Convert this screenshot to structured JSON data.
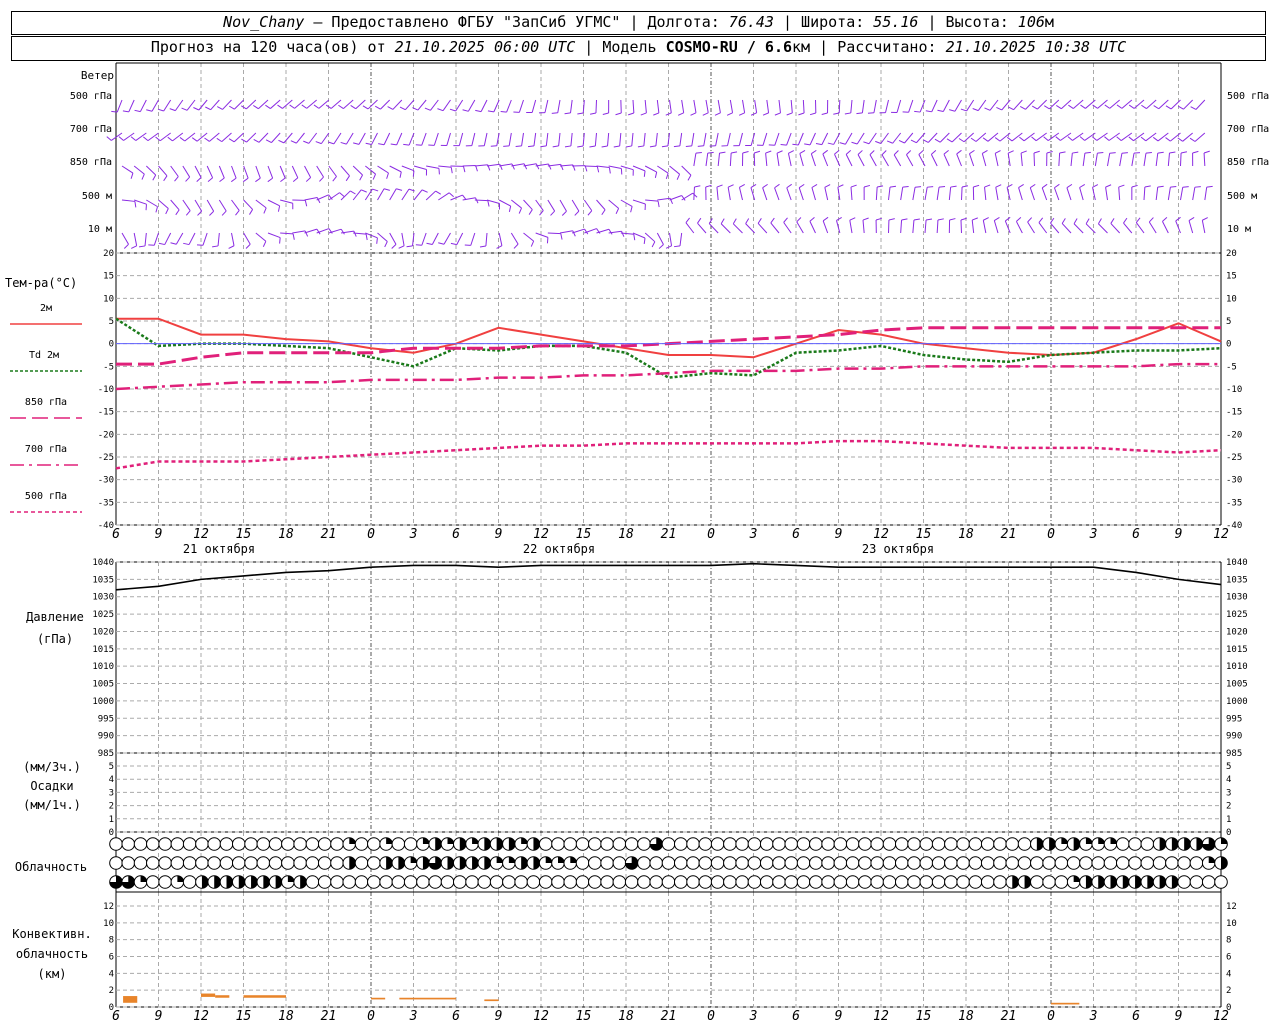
{
  "header": {
    "station": "Nov_Chany",
    "provider": "— Предоставлено ФГБУ \"ЗапСиб УГМС\"",
    "lon_label": "Долгота:",
    "lon": "76.43",
    "lat_label": "Широта:",
    "lat": "55.16",
    "alt_label": "Высота:",
    "alt": "106",
    "alt_unit": "м",
    "forecast_label": "Прогноз на 120 часа(ов) от",
    "forecast_start": "21.10.2025 06:00 UTC",
    "model_label": "Модель",
    "model": "COSMO-RU / 6.6",
    "model_unit": "км",
    "calc_label": "Рассчитано:",
    "calc_time": "21.10.2025 10:38 UTC"
  },
  "wind_panel": {
    "title": "Ветер",
    "levels": [
      "500 гПа",
      "700 гПа",
      "850 гПа",
      "500 м",
      "10  м"
    ],
    "barb_color": "#8a2be2"
  },
  "temp_panel": {
    "title": "Тем-ра(°C)",
    "legend": [
      {
        "label": "2м",
        "color": "#f04040",
        "dash": "solid"
      },
      {
        "label": "Td  2м",
        "color": "#1a7a1a",
        "dash": "dot"
      },
      {
        "label": "850 гПа",
        "color": "#e0207a",
        "dash": "long"
      },
      {
        "label": "700 гПа",
        "color": "#e0207a",
        "dash": "dashdot"
      },
      {
        "label": "500 гПа",
        "color": "#e0207a",
        "dash": "short"
      }
    ],
    "yticks": [
      "20",
      "15",
      "10",
      "5",
      "0",
      "-5",
      "-10",
      "-15",
      "-20",
      "-25",
      "-30",
      "-35",
      "-40"
    ]
  },
  "time_axis": {
    "hour_labels": [
      "6",
      "9",
      "12",
      "15",
      "18",
      "21",
      "0",
      "3",
      "6",
      "9",
      "12",
      "15",
      "18",
      "21",
      "0",
      "3",
      "6",
      "9",
      "12",
      "15",
      "18",
      "21",
      "0",
      "3",
      "6",
      "9",
      "12"
    ],
    "dates": [
      "21 октября",
      "22 октября",
      "23 октября"
    ]
  },
  "pressure_panel": {
    "title": "Давление",
    "unit": "(гПа)",
    "yticks": [
      "1040",
      "1035",
      "1030",
      "1025",
      "1020",
      "1015",
      "1010",
      "1005",
      "1000",
      "995",
      "990",
      "985"
    ]
  },
  "precip_panel": {
    "unit1": "(мм/3ч.)",
    "title": "Осадки",
    "unit2": "(мм/1ч.)",
    "yticks": [
      "5",
      "4",
      "3",
      "2",
      "1",
      "0"
    ]
  },
  "cloud_panel": {
    "title": "Облачность"
  },
  "conv_panel": {
    "title1": "Конвективн.",
    "title2": "облачность",
    "unit": "(км)",
    "yticks": [
      "12",
      "10",
      "8",
      "6",
      "4",
      "2",
      "0"
    ],
    "bar_color": "#e8842a"
  },
  "chart_data": [
    {
      "type": "line",
      "title": "Тем-ра(°C)",
      "x": [
        0,
        3,
        6,
        9,
        12,
        15,
        18,
        21,
        24,
        27,
        30,
        33,
        36,
        39,
        42,
        45,
        48,
        51,
        54,
        57,
        60,
        63,
        66,
        69,
        72,
        75,
        78
      ],
      "ylim": [
        -40,
        20
      ],
      "series": [
        {
          "name": "2м",
          "values": [
            5.5,
            5.5,
            2,
            2,
            1,
            0.5,
            -1,
            -2,
            0,
            3.5,
            2,
            0.5,
            -1,
            -2.5,
            -2.5,
            -3,
            0,
            3,
            2,
            0,
            -1,
            -2,
            -2.5,
            -2,
            1,
            4.5,
            0.5
          ]
        },
        {
          "name": "Td  2м",
          "values": [
            5.5,
            -0.5,
            0,
            0,
            -0.5,
            -1,
            -3,
            -5,
            -1,
            -1.5,
            -0.5,
            -0.5,
            -2,
            -7.5,
            -6.5,
            -7,
            -2,
            -1.5,
            -0.5,
            -2.5,
            -3.5,
            -4,
            -2.5,
            -2,
            -1.5,
            -1.5,
            -1
          ]
        },
        {
          "name": "850 гПа",
          "values": [
            -4.5,
            -4.5,
            -3,
            -2,
            -2,
            -2,
            -2,
            -1,
            -1,
            -1,
            -0.5,
            -0.5,
            -0.5,
            0,
            0.5,
            1,
            1.5,
            2,
            3,
            3.5,
            3.5,
            3.5,
            3.5,
            3.5,
            3.5,
            3.5,
            3.5
          ]
        },
        {
          "name": "700 гПа",
          "values": [
            -10,
            -9.5,
            -9,
            -8.5,
            -8.5,
            -8.5,
            -8,
            -8,
            -8,
            -7.5,
            -7.5,
            -7,
            -7,
            -6.5,
            -6,
            -6,
            -6,
            -5.5,
            -5.5,
            -5,
            -5,
            -5,
            -5,
            -5,
            -5,
            -4.5,
            -4.5
          ]
        },
        {
          "name": "500 гПа",
          "values": [
            -27.5,
            -26,
            -26,
            -26,
            -25.5,
            -25,
            -24.5,
            -24,
            -23.5,
            -23,
            -22.5,
            -22.5,
            -22,
            -22,
            -22,
            -22,
            -22,
            -21.5,
            -21.5,
            -22,
            -22.5,
            -23,
            -23,
            -23,
            -23.5,
            -24,
            -23.5
          ]
        }
      ]
    },
    {
      "type": "line",
      "title": "Давление",
      "x": [
        0,
        3,
        6,
        9,
        12,
        15,
        18,
        21,
        24,
        27,
        30,
        33,
        36,
        39,
        42,
        45,
        48,
        51,
        54,
        57,
        60,
        63,
        66,
        69,
        72,
        75,
        78
      ],
      "ylim": [
        985,
        1040
      ],
      "series": [
        {
          "name": "Давление",
          "values": [
            1032,
            1033,
            1035,
            1036,
            1037,
            1037.5,
            1038.5,
            1039,
            1039,
            1038.5,
            1039,
            1039,
            1039,
            1039,
            1039,
            1039.5,
            1039,
            1038.5,
            1038.5,
            1038.5,
            1038.5,
            1038.5,
            1038.5,
            1038.5,
            1037,
            1035,
            1033.5
          ]
        }
      ]
    },
    {
      "type": "bar",
      "title": "Конвективн. облачность",
      "ylim": [
        0,
        12
      ],
      "bars": [
        {
          "x0": 0.5,
          "x1": 1.5,
          "h0": 0.5,
          "h1": 1.3
        },
        {
          "x0": 6,
          "x1": 7,
          "h0": 1.2,
          "h1": 1.6
        },
        {
          "x0": 7,
          "x1": 8,
          "h0": 1.1,
          "h1": 1.4
        },
        {
          "x0": 9,
          "x1": 12,
          "h0": 1.1,
          "h1": 1.4
        },
        {
          "x0": 18,
          "x1": 19,
          "h0": 0.9,
          "h1": 1.1
        },
        {
          "x0": 20,
          "x1": 24,
          "h0": 0.9,
          "h1": 1.1
        },
        {
          "x0": 26,
          "x1": 27,
          "h0": 0.7,
          "h1": 0.9
        },
        {
          "x0": 66,
          "x1": 68,
          "h0": 0.3,
          "h1": 0.5
        }
      ]
    }
  ],
  "cloud_rows": [
    "0000000000000000000100100121212221200000000030000000000000000000000000000002212111000222231",
    "0000000000000000000200221232222112211100003000000000000000000000000000000000000000000000012",
    "3310010222222212000000000000000000000000000000000000000000000000000000000220001222222220000"
  ]
}
